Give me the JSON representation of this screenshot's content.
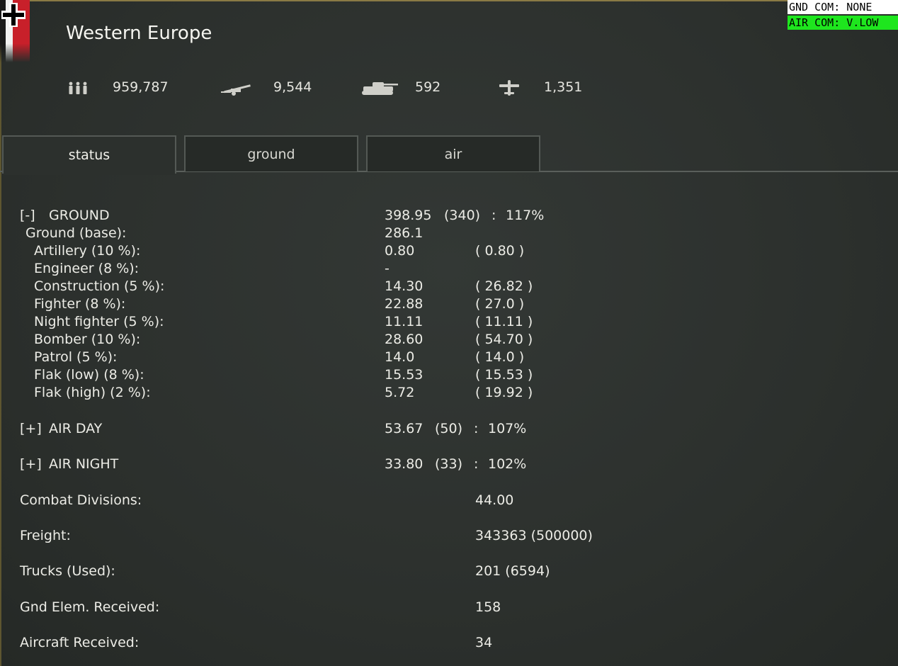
{
  "header": {
    "region": "Western Europe",
    "gnd_com": "GND COM: NONE",
    "air_com": "AIR COM: V.LOW"
  },
  "summary": {
    "men": "959,787",
    "guns": "9,544",
    "tanks": "592",
    "aircraft": "1,351"
  },
  "tabs": [
    "status",
    "ground",
    "air"
  ],
  "ground": {
    "toggle": "[-]",
    "label": "GROUND",
    "value": "398.95",
    "need": "(340)",
    "sep": ":",
    "pct": "117%",
    "base_label": "Ground (base):",
    "base_value": "286.1",
    "items": [
      {
        "label": "Artillery (10 %):",
        "value": "0.80",
        "max": "( 0.80 )"
      },
      {
        "label": "Engineer (8 %):",
        "value": "-",
        "max": ""
      },
      {
        "label": "Construction (5 %):",
        "value": "14.30",
        "max": "( 26.82 )"
      },
      {
        "label": "Fighter (8 %):",
        "value": "22.88",
        "max": "( 27.0 )"
      },
      {
        "label": "Night fighter (5 %):",
        "value": "11.11",
        "max": "( 11.11 )"
      },
      {
        "label": "Bomber (10 %):",
        "value": "28.60",
        "max": "( 54.70 )"
      },
      {
        "label": "Patrol (5 %):",
        "value": "14.0",
        "max": "( 14.0 )"
      },
      {
        "label": "Flak (low) (8 %):",
        "value": "15.53",
        "max": "( 15.53 )"
      },
      {
        "label": "Flak (high) (2 %):",
        "value": "5.72",
        "max": "( 19.92 )"
      }
    ]
  },
  "air_day": {
    "toggle": "[+]",
    "label": "AIR DAY",
    "value": "53.67",
    "need": "(50)",
    "sep": ":",
    "pct": "107%"
  },
  "air_night": {
    "toggle": "[+]",
    "label": "AIR NIGHT",
    "value": "33.80",
    "need": "(33)",
    "sep": ":",
    "pct": "102%"
  },
  "info": [
    {
      "label": "Combat Divisions:",
      "value": "44.00"
    },
    {
      "label": "Freight:",
      "value": "343363 (500000)"
    },
    {
      "label": "Trucks (Used):",
      "value": "201 (6594)"
    },
    {
      "label": "Gnd Elem. Received:",
      "value": "158"
    },
    {
      "label": "Aircraft Received:",
      "value": "34"
    }
  ],
  "colors": {
    "background": "#2b2f2c",
    "text": "#ecece6",
    "air_com_bg": "#1ee61e",
    "gnd_com_bg": "#ffffff"
  }
}
